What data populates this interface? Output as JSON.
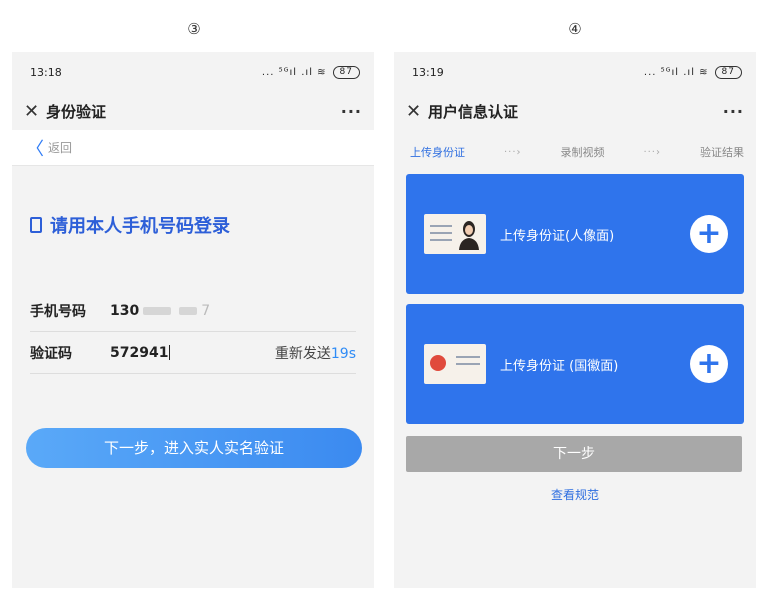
{
  "steps": {
    "left": "③",
    "right": "④"
  },
  "phone1": {
    "status": {
      "time": "13:18",
      "signal": "... ⁵ᴳıl .ıl ≋",
      "battery": "87"
    },
    "title": "身份验证",
    "close": "✕",
    "more": "···",
    "back": {
      "chevron": "〈",
      "label": "返回"
    },
    "heading": "请用本人手机号码登录",
    "phone_row": {
      "label": "手机号码",
      "value_prefix": "130",
      "value_suffix": "7"
    },
    "code_row": {
      "label": "验证码",
      "value": "572941",
      "resend": "重新发送",
      "resend_count": "19s"
    },
    "submit": "下一步，进入实人实名验证"
  },
  "phone2": {
    "status": {
      "time": "13:19",
      "signal": "... ⁵ᴳıl .ıl ≋",
      "battery": "87"
    },
    "title": "用户信息认证",
    "close": "✕",
    "more": "···",
    "progress": {
      "step1": "上传身份证",
      "step2": "录制视频",
      "step3": "验证结果",
      "arrow": "···›"
    },
    "card_front": "上传身份证(人像面)",
    "card_back": "上传身份证 (国徽面)",
    "plus": "+",
    "next": "下一步",
    "spec": "查看规范"
  },
  "colors": {
    "brand_blue": "#2f74ec",
    "button_gradient_start": "#5aa9f8",
    "button_gradient_end": "#3b8af0",
    "disabled_gray": "#a8a8a8"
  }
}
